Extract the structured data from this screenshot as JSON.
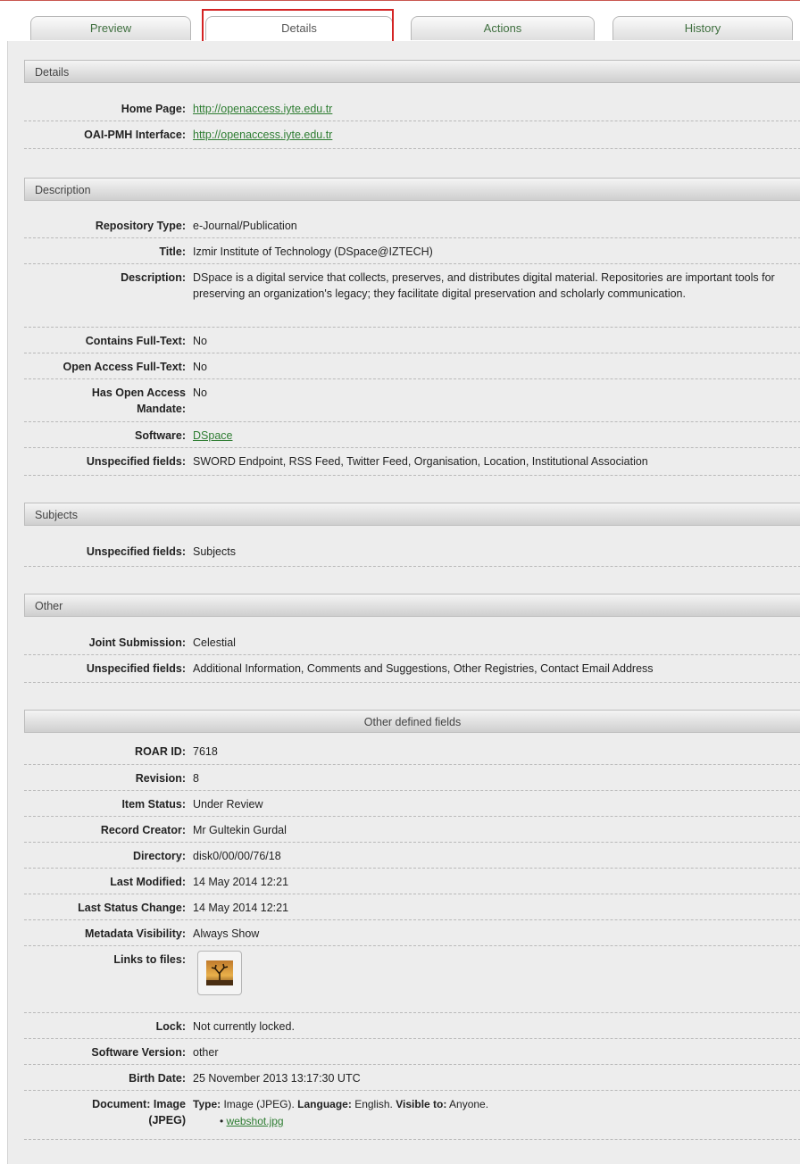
{
  "tabs": [
    "Preview",
    "Details",
    "Actions",
    "History"
  ],
  "sections": {
    "details": "Details",
    "description": "Description",
    "subjects": "Subjects",
    "other": "Other",
    "other_defined": "Other defined fields"
  },
  "details": {
    "home_page_label": "Home Page:",
    "home_page_value": "http://openaccess.iyte.edu.tr",
    "oai_label": "OAI-PMH Interface:",
    "oai_value": "http://openaccess.iyte.edu.tr"
  },
  "description": {
    "repo_type_label": "Repository Type:",
    "repo_type_value": "e-Journal/Publication",
    "title_label": "Title:",
    "title_value": "Izmir Institute of Technology (DSpace@IZTECH)",
    "description_label": "Description:",
    "description_value": "DSpace is a digital service that collects, preserves, and distributes digital material. Repositories are important tools for preserving an organization's legacy; they facilitate digital preservation and scholarly communication.",
    "contains_fulltext_label": "Contains Full-Text:",
    "contains_fulltext_value": "No",
    "open_access_label": "Open Access Full-Text:",
    "open_access_value": "No",
    "mandate_label": "Has Open Access Mandate:",
    "mandate_value": "No",
    "software_label": "Software:",
    "software_value": "DSpace",
    "unspecified_label": "Unspecified fields:",
    "unspecified_value": "SWORD Endpoint, RSS Feed, Twitter Feed, Organisation, Location, Institutional Association"
  },
  "subjects": {
    "unspecified_label": "Unspecified fields:",
    "unspecified_value": "Subjects"
  },
  "other": {
    "joint_label": "Joint Submission:",
    "joint_value": "Celestial",
    "unspecified_label": "Unspecified fields:",
    "unspecified_value": "Additional Information, Comments and Suggestions, Other Registries, Contact Email Address"
  },
  "other_defined": {
    "roar_id_label": "ROAR ID:",
    "roar_id_value": "7618",
    "revision_label": "Revision:",
    "revision_value": "8",
    "item_status_label": "Item Status:",
    "item_status_value": "Under Review",
    "record_creator_label": "Record Creator:",
    "record_creator_value": "Mr Gultekin Gurdal",
    "directory_label": "Directory:",
    "directory_value": "disk0/00/00/76/18",
    "last_modified_label": "Last Modified:",
    "last_modified_value": "14 May 2014 12:21",
    "last_status_label": "Last Status Change:",
    "last_status_value": "14 May 2014 12:21",
    "metadata_vis_label": "Metadata Visibility:",
    "metadata_vis_value": "Always Show",
    "links_label": "Links to files:",
    "lock_label": "Lock:",
    "lock_value": "Not currently locked.",
    "software_version_label": "Software Version:",
    "software_version_value": "other",
    "birth_date_label": "Birth Date:",
    "birth_date_value": "25 November 2013 13:17:30 UTC",
    "document_label": "Document: Image (JPEG)",
    "doc_type_label": "Type:",
    "doc_type_value": "Image (JPEG).",
    "doc_language_label": "Language:",
    "doc_language_value": "English.",
    "doc_visible_label": "Visible to:",
    "doc_visible_value": "Anyone.",
    "doc_file": "webshot.jpg"
  },
  "colors": {
    "link": "#2e7d32",
    "highlight": "#d42424",
    "panel_bg": "#ededed"
  },
  "icons": {
    "file_thumbnail": "image-thumbnail-icon"
  }
}
